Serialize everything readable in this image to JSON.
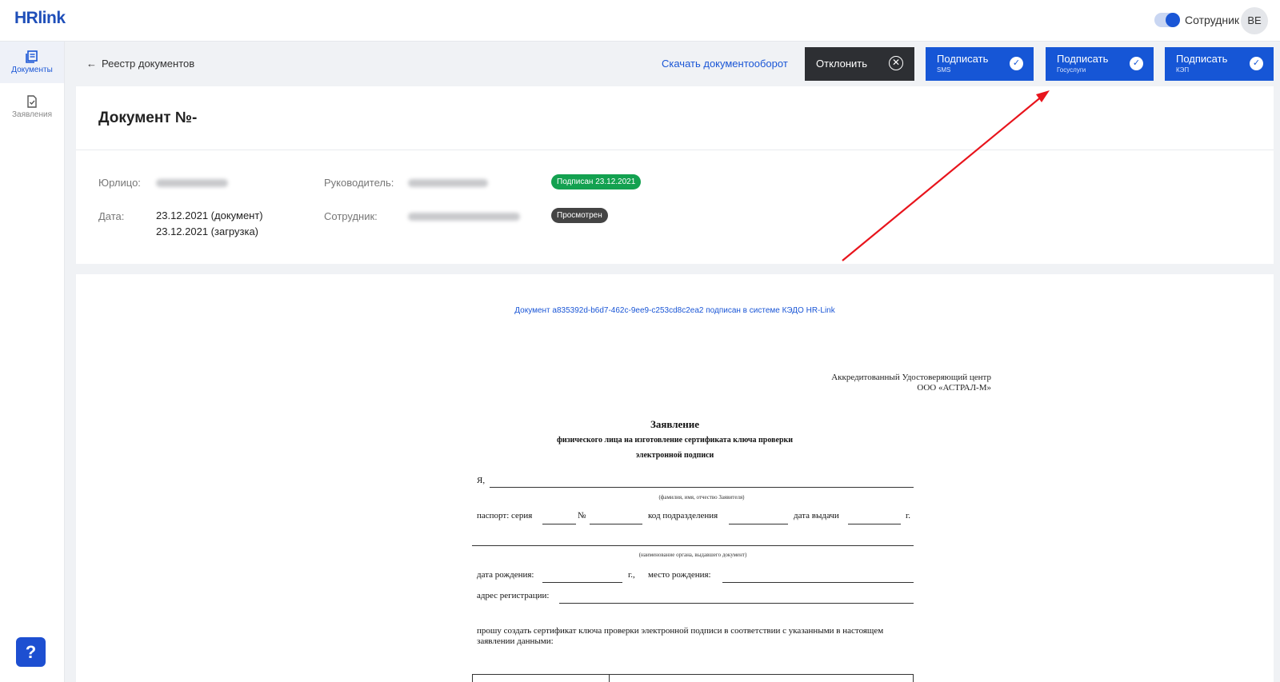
{
  "brand": {
    "logo": "HRlink"
  },
  "header": {
    "role_label": "Сотрудник",
    "avatar_initials": "ВЕ",
    "role_toggle_on": true
  },
  "sidebar": {
    "items": [
      {
        "label": "Документы",
        "icon": "documents-icon",
        "active": true
      },
      {
        "label": "Заявления",
        "icon": "application-icon",
        "active": false
      }
    ],
    "help": "?"
  },
  "toolbar": {
    "back_label": "Реестр документов",
    "download_label": "Скачать документооборот",
    "reject_label": "Отклонить",
    "sign_buttons": [
      {
        "label": "Подписать",
        "sub": "SMS"
      },
      {
        "label": "Подписать",
        "sub": "Госуслуги"
      },
      {
        "label": "Подписать",
        "sub": "КЭП"
      }
    ]
  },
  "document": {
    "title": "Документ №-",
    "labels": {
      "entity": "Юрлицо:",
      "manager": "Руководитель:",
      "date": "Дата:",
      "employee": "Сотрудник:"
    },
    "date_document": "23.12.2021 (документ)",
    "date_upload": "23.12.2021 (загрузка)",
    "status_signed": "Подписан 23.12.2021",
    "status_viewed": "Просмотрен"
  },
  "preview": {
    "stamp": "Документ a835392d-b6d7-462c-9ee9-c253cd8c2ea2 подписан в системе КЭДО HR-Link",
    "center_line1": "Аккредитованный Удостоверяющий центр",
    "center_line2": "ООО «АСТРАЛ-М»",
    "heading": "Заявление",
    "subheading1": "физического лица на изготовление сертификата ключа проверки",
    "subheading2": "электронной подписи",
    "i_label": "Я,",
    "fio_caption": "(фамилия, имя, отчество Заявителя)",
    "passport_series": "паспорт: серия",
    "number_sign": "№",
    "dept_code": "код подразделения",
    "issue_date": "дата выдачи",
    "year_suffix": "г.",
    "issuer_caption": "(наименование органа, выдавшего документ)",
    "birth_date": "дата рождения:",
    "birth_year_suffix": "г.,",
    "birth_place": "место рождения:",
    "reg_address": "адрес регистрации:",
    "request_line1": "прошу создать сертификат ключа проверки электронной подписи в соответствии с указанными в настоящем",
    "request_line2": "заявлении данными:"
  }
}
